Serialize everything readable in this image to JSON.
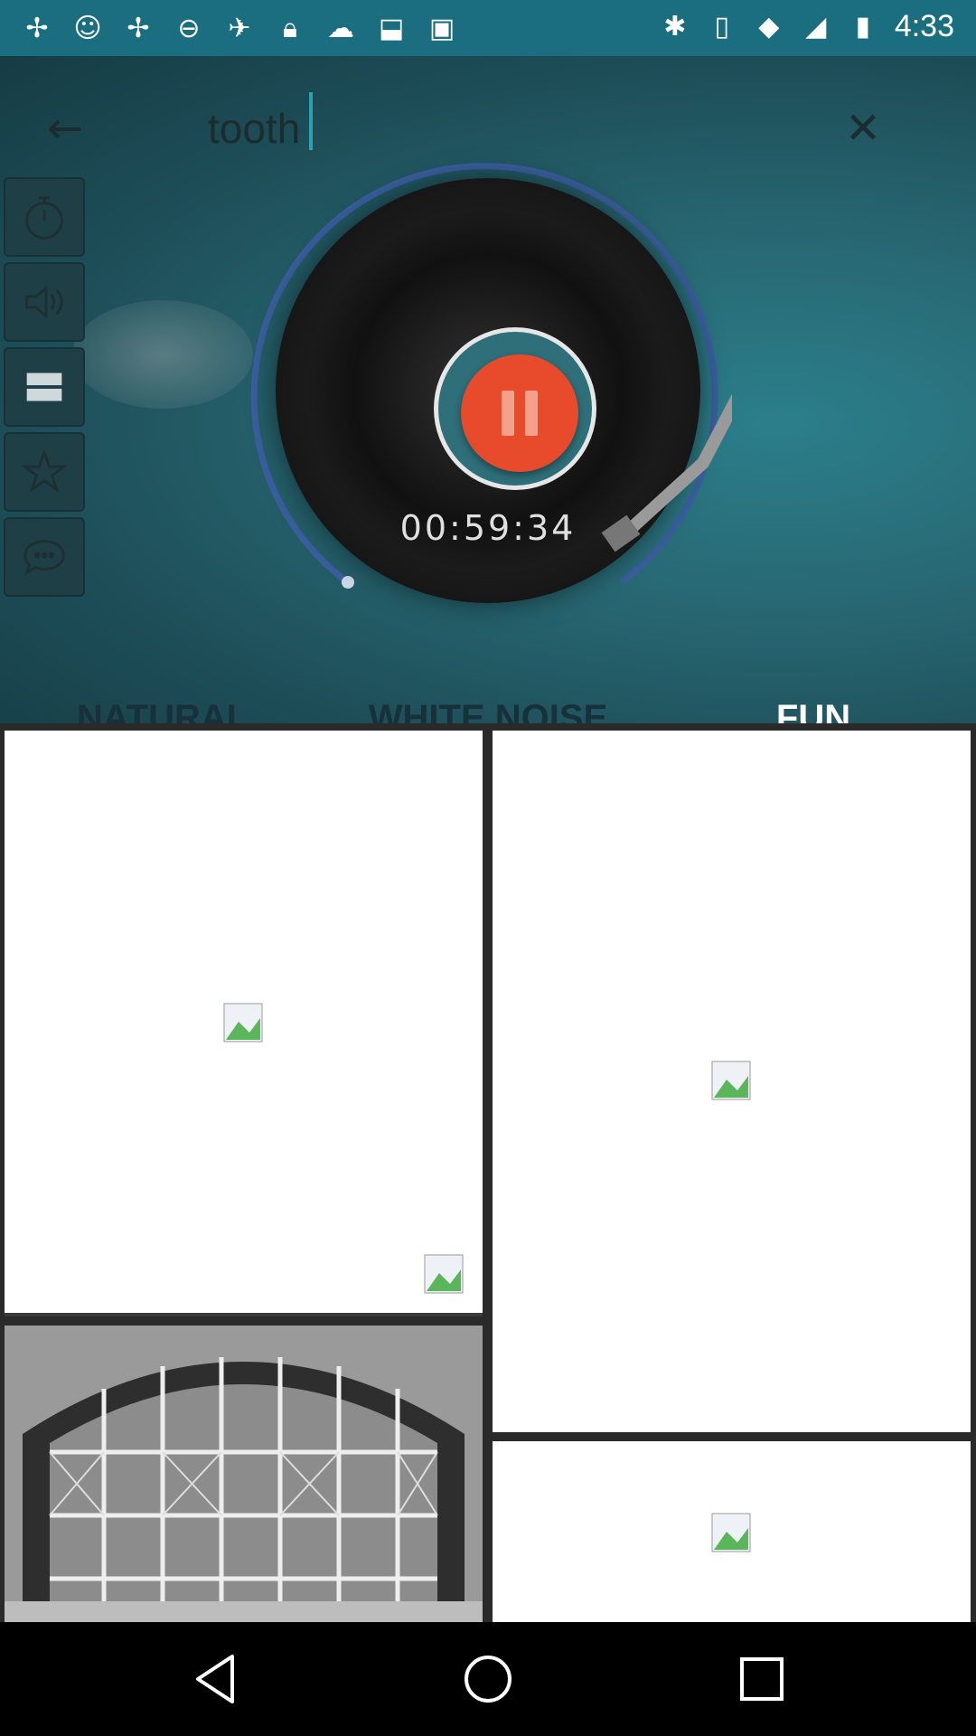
{
  "status_bar": {
    "time": "4:33",
    "icons": [
      "fan-icon",
      "headset-icon",
      "fan-icon",
      "do-not-disturb-icon",
      "satellite-icon",
      "lock-icon",
      "cloud-icon",
      "inbox-icon",
      "briefcase-icon"
    ]
  },
  "search": {
    "value": "tooth",
    "back_icon": "arrow-back-icon",
    "close_icon": "close-icon"
  },
  "side_tools": [
    "timer-icon",
    "volume-icon",
    "layout-icon",
    "star-icon",
    "chat-icon"
  ],
  "player": {
    "elapsed": "00:59:34",
    "state": "playing",
    "accent": "#e84a2c"
  },
  "tabs": [
    {
      "label": "NATURAL",
      "selected": false
    },
    {
      "label": "WHITE NOISE",
      "selected": false
    },
    {
      "label": "FUN",
      "selected": true
    }
  ],
  "colors": {
    "tab_indicator": "#2d9aa8",
    "hero_bg": "#286873"
  },
  "navigation": [
    "back-nav-icon",
    "home-nav-icon",
    "recents-nav-icon"
  ]
}
